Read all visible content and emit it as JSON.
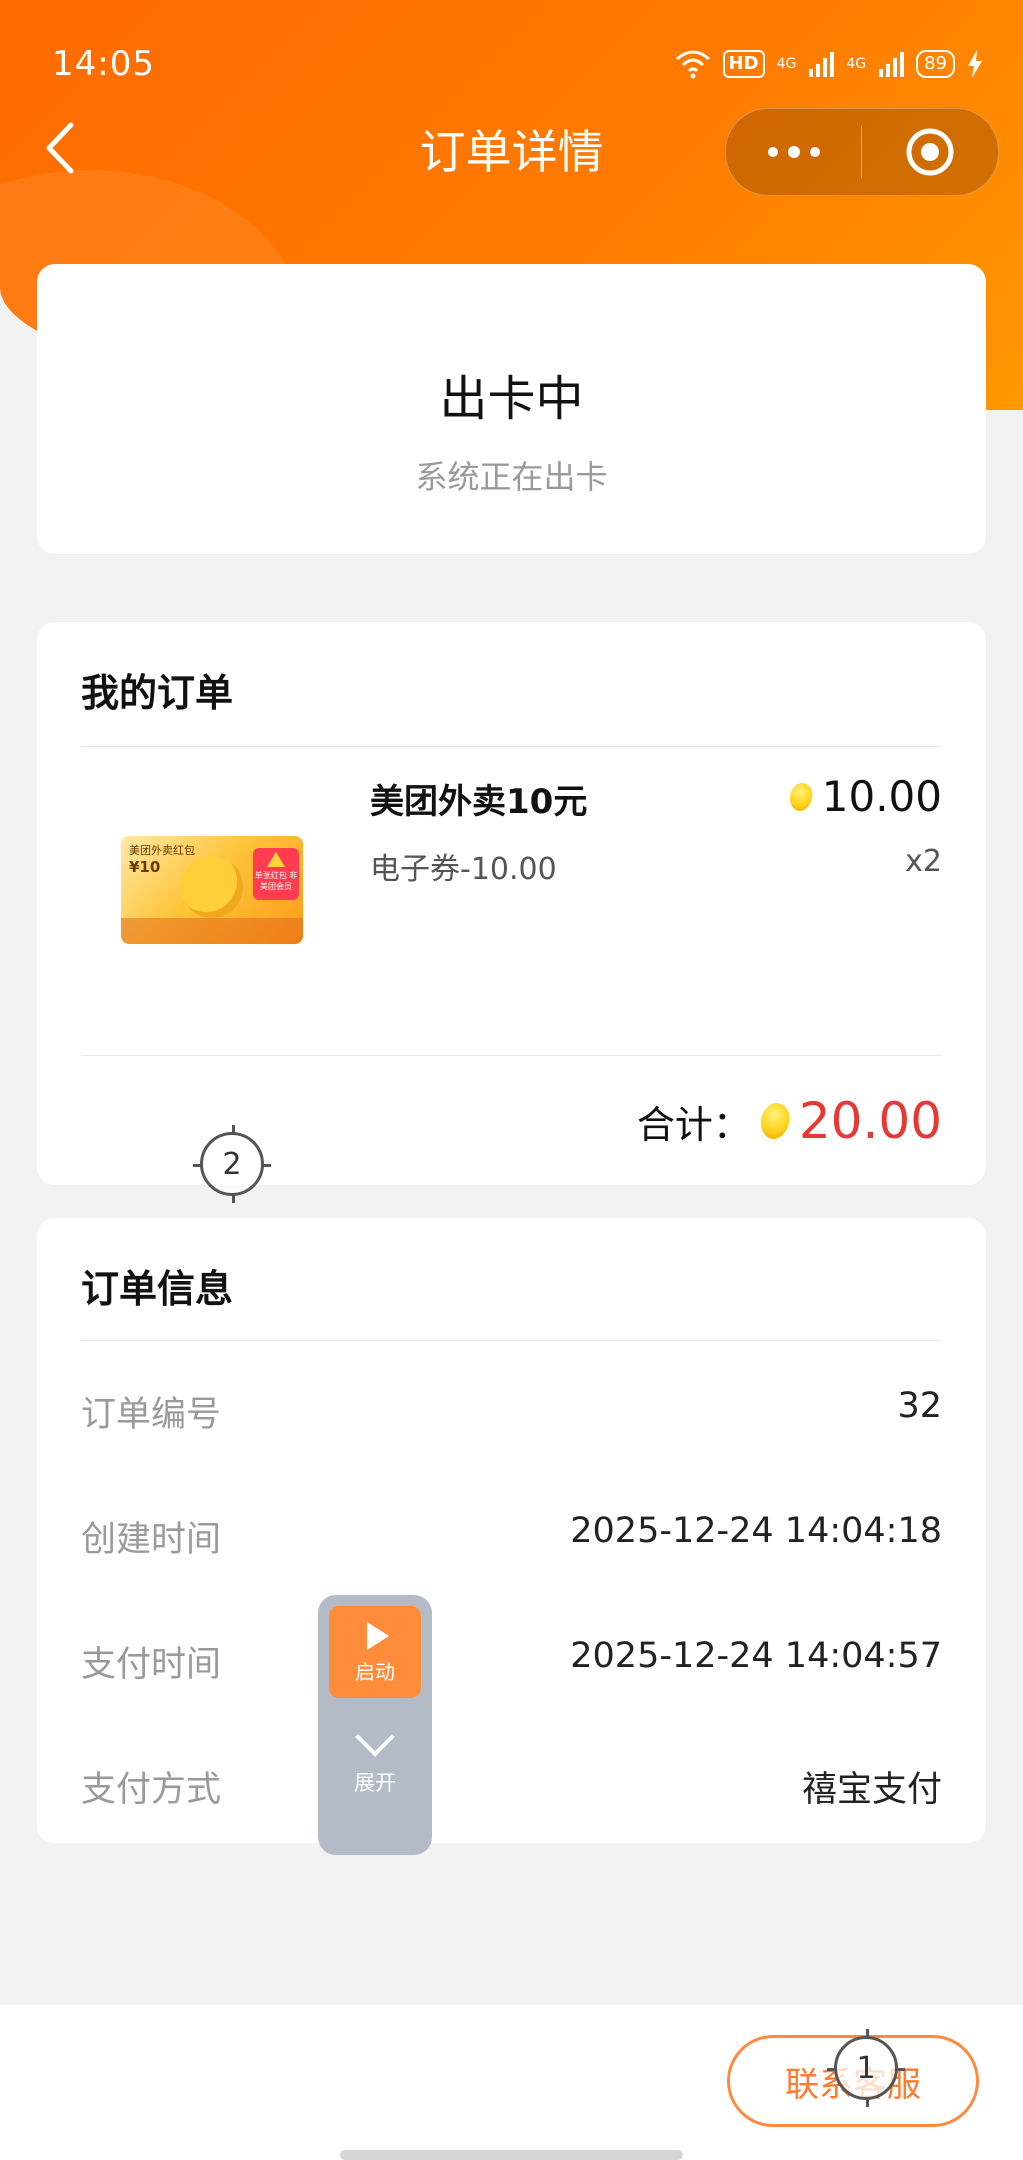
{
  "status_bar": {
    "time": "14:05",
    "hd_label": "HD",
    "signal1": "4G",
    "signal2": "4G",
    "battery": "89"
  },
  "nav": {
    "title": "订单详情"
  },
  "order_status": {
    "title": "出卡中",
    "subtitle": "系统正在出卡"
  },
  "my_order": {
    "section_title": "我的订单",
    "product": {
      "image_text_top": "美团外卖红包",
      "image_text_value": "¥10",
      "image_badge": "单张红包 非美团会员",
      "name": "美团外卖10元",
      "desc": "电子券-10.00",
      "price": "10.00",
      "qty": "x2"
    },
    "total_label": "合计：",
    "total_value": "20.00"
  },
  "markers": {
    "m1": "1",
    "m2": "2"
  },
  "order_info": {
    "section_title": "订单信息",
    "rows": [
      {
        "label": "订单编号",
        "value": "32"
      },
      {
        "label": "创建时间",
        "value": "2025-12-24 14:04:18"
      },
      {
        "label": "支付时间",
        "value": "2025-12-24 14:04:57"
      },
      {
        "label": "支付方式",
        "value": "禧宝支付"
      }
    ]
  },
  "float_widget": {
    "start_label": "启动",
    "expand_label": "展开"
  },
  "bottom": {
    "contact_label": "联系客服"
  },
  "colors": {
    "brand_orange": "#ff6a00",
    "price_red": "#e53935",
    "button_orange": "#ff7a2a"
  }
}
